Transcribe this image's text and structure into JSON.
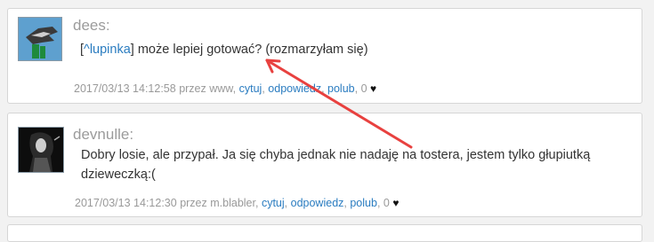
{
  "posts": [
    {
      "username": "dees:",
      "content": {
        "ref_open": "[",
        "ref_link": "^lupinka",
        "ref_close": "]",
        "text": " może lepiej gotować? (rozmarzyłam się)"
      },
      "meta": {
        "timestamp": "2017/03/13 14:12:58",
        "by_label": "przez",
        "author": "www",
        "sep": ",",
        "quote": "cytuj",
        "reply": "odpowiedz",
        "like": "polub",
        "likes": "0"
      }
    },
    {
      "username": "devnulle:",
      "content": {
        "text": "Dobry losie, ale przypał. Ja się chyba jednak nie nadaję na tostera, jestem tylko głupiutką dzieweczką:("
      },
      "meta": {
        "timestamp": "2017/03/13 14:12:30",
        "by_label": "przez",
        "author": "m.blabler",
        "sep": ",",
        "quote": "cytuj",
        "reply": "odpowiedz",
        "like": "polub",
        "likes": "0"
      }
    }
  ],
  "colors": {
    "link": "#2a7cc0",
    "username": "#9b9b9b",
    "meta": "#999999",
    "arrow": "#e8413f",
    "avatar_bg_1": "#5ea0cf",
    "avatar_bg_2": "#111111"
  },
  "icons": {
    "heart": "heart-icon",
    "annotation": "red-arrow"
  }
}
